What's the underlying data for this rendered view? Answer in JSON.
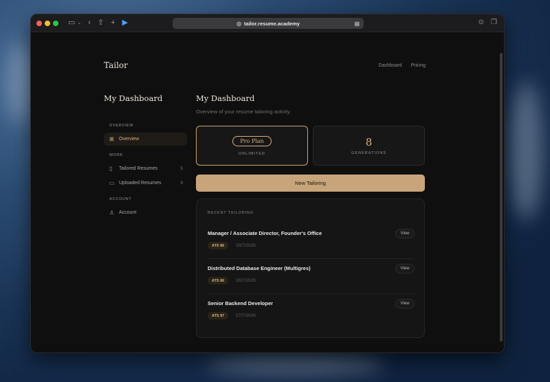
{
  "browser": {
    "url": "tailor.resume.academy"
  },
  "header": {
    "brand": "Tailor",
    "nav": [
      {
        "label": "Dashboard"
      },
      {
        "label": "Pricing"
      }
    ]
  },
  "sidebar": {
    "title": "My Dashboard",
    "sections": {
      "overview": "OVERVIEW",
      "work": "WORK",
      "account": "ACCOUNT"
    },
    "items": [
      {
        "label": "Overview",
        "icon": "grid-icon",
        "active": true
      },
      {
        "label": "Tailored Resumes",
        "icon": "document-icon",
        "count": "5"
      },
      {
        "label": "Uploaded Resumes",
        "icon": "folder-icon",
        "count": "9"
      },
      {
        "label": "Account",
        "icon": "user-icon"
      }
    ]
  },
  "main": {
    "title": "My Dashboard",
    "subtitle": "Overview of your resume tailoring activity.",
    "plan_card": {
      "pill": "Pro Plan",
      "label": "UNLIMITED"
    },
    "gens_card": {
      "value": "8",
      "label": "GENERATIONS"
    },
    "cta_label": "New Tailoring",
    "recent": {
      "label": "RECENT TAILORING",
      "rows": [
        {
          "title": "Manager / Associate Director, Founder's Office",
          "badge": "ATS 86",
          "date": "29/7/2026",
          "view": "View"
        },
        {
          "title": "Distributed Database Engineer (Multigres)",
          "badge": "ATS 86",
          "date": "28/7/2026",
          "view": "View"
        },
        {
          "title": "Senior Backend Developer",
          "badge": "ATS 87",
          "date": "27/7/2026",
          "view": "View"
        }
      ]
    }
  },
  "colors": {
    "accent": "#d7b27e",
    "cta_bg": "#c8a47a",
    "page_bg": "#0f0f0f"
  }
}
